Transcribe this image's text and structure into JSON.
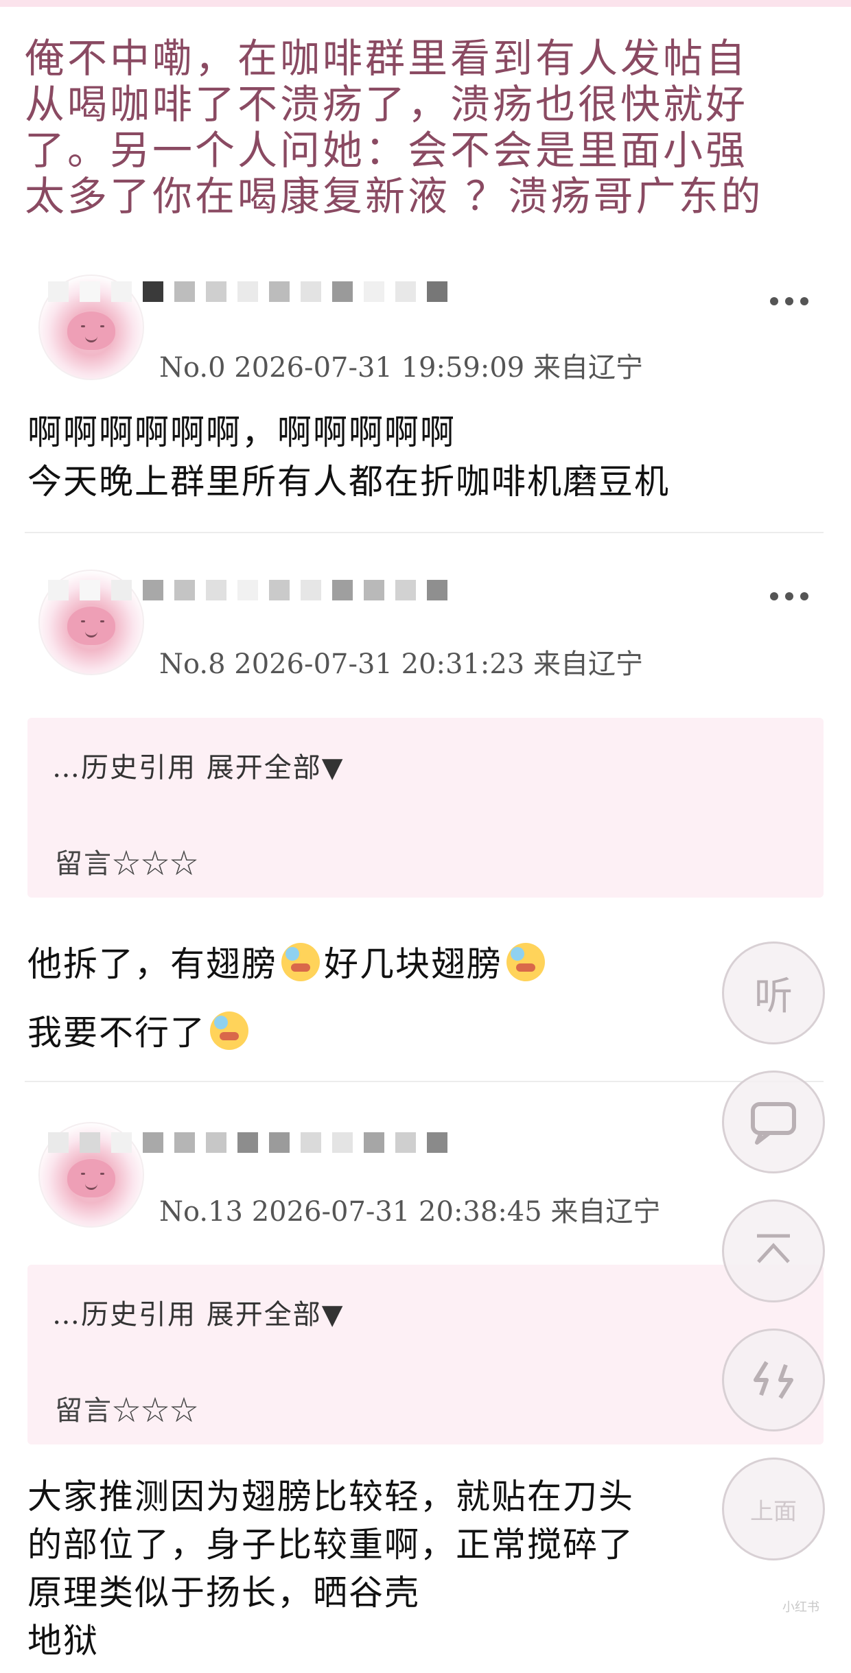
{
  "header": {
    "lines": [
      "俺不中嘞，在咖啡群里看到有人发帖自",
      "从喝咖啡了不溃疡了，溃疡也很快就好",
      "了。另一个人问她：会不会是里面小强",
      "太多了你在喝康复新液 ？溃疡哥广东的"
    ]
  },
  "posts": [
    {
      "meta": "No.0 2026-07-31 19:59:09 来自辽宁",
      "lines": [
        "啊啊啊啊啊啊，啊啊啊啊啊",
        "今天晚上群里所有人都在折咖啡机磨豆机"
      ]
    },
    {
      "meta": "No.8 2026-07-31 20:31:23 来自辽宁",
      "quote_expand": "…历史引用 展开全部▼",
      "quote_msg": "留言☆☆☆",
      "line1a": "他拆了，有翅膀",
      "line1b": "好几块翅膀",
      "line2": "我要不行了"
    },
    {
      "meta": "No.13 2026-07-31 20:38:45 来自辽宁",
      "quote_expand": "…历史引用 展开全部▼",
      "quote_msg": "留言☆☆☆",
      "lines": [
        "大家推测因为翅膀比较轻，就贴在刀头",
        "的部位了，身子比较重啊，正常搅碎了",
        "原理类似于扬长，晒谷壳",
        "地狱"
      ]
    }
  ],
  "fabs": {
    "listen_label": "听",
    "comment_icon": "speech-bubble-icon",
    "top_icon": "back-to-top-icon",
    "refresh_icon": "refresh-icon",
    "up_label": "上面"
  },
  "watermark": "小红书",
  "colors": {
    "title": "#8a4a62",
    "quote_bg": "#fdf0f5",
    "topbar": "#fbe3ec"
  }
}
